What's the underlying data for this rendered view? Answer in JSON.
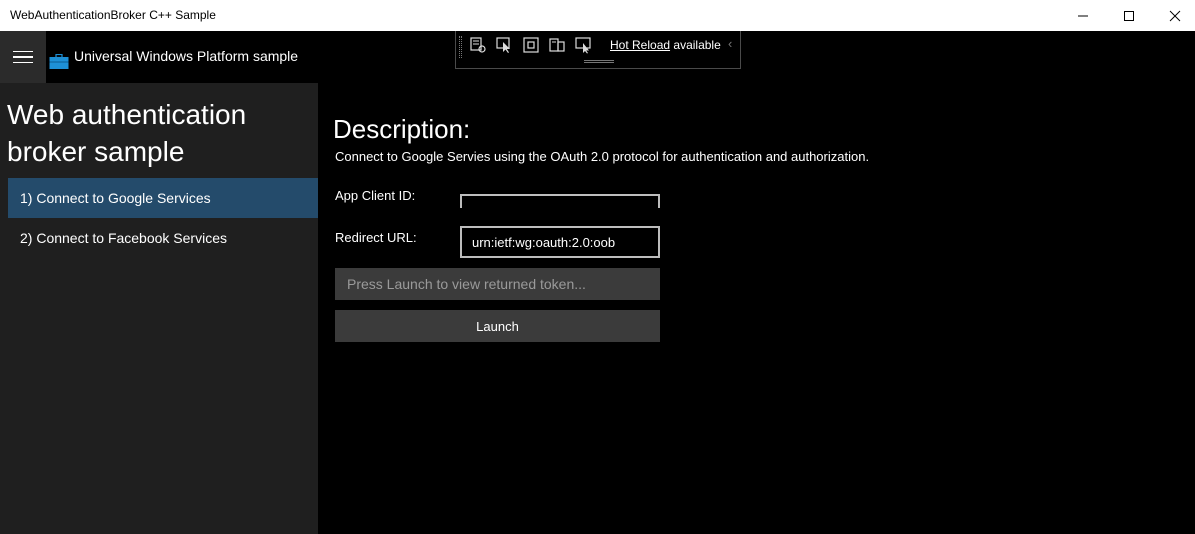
{
  "window": {
    "title": "WebAuthenticationBroker C++ Sample"
  },
  "header": {
    "app_title": "Universal Windows Platform sample"
  },
  "sidebar": {
    "title": "Web authentication broker sample",
    "scenarios": [
      {
        "label": "1) Connect to Google Services",
        "selected": true
      },
      {
        "label": "2) Connect to Facebook Services",
        "selected": false
      }
    ]
  },
  "main": {
    "description_heading": "Description:",
    "description_text": "Connect to Google Servies using the OAuth 2.0 protocol for authentication and authorization.",
    "client_id_label": "App Client ID:",
    "client_id_value": "",
    "redirect_label": "Redirect URL:",
    "redirect_value": "urn:ietf:wg:oauth:2.0:oob",
    "token_placeholder": "Press Launch to view returned token...",
    "launch_label": "Launch"
  },
  "hot_reload": {
    "link": "Hot Reload",
    "status": "available"
  },
  "colors": {
    "selected_item": "#244b6b",
    "sidebar_bg": "#1f1f1f",
    "button_bg": "#3b3b3b"
  }
}
